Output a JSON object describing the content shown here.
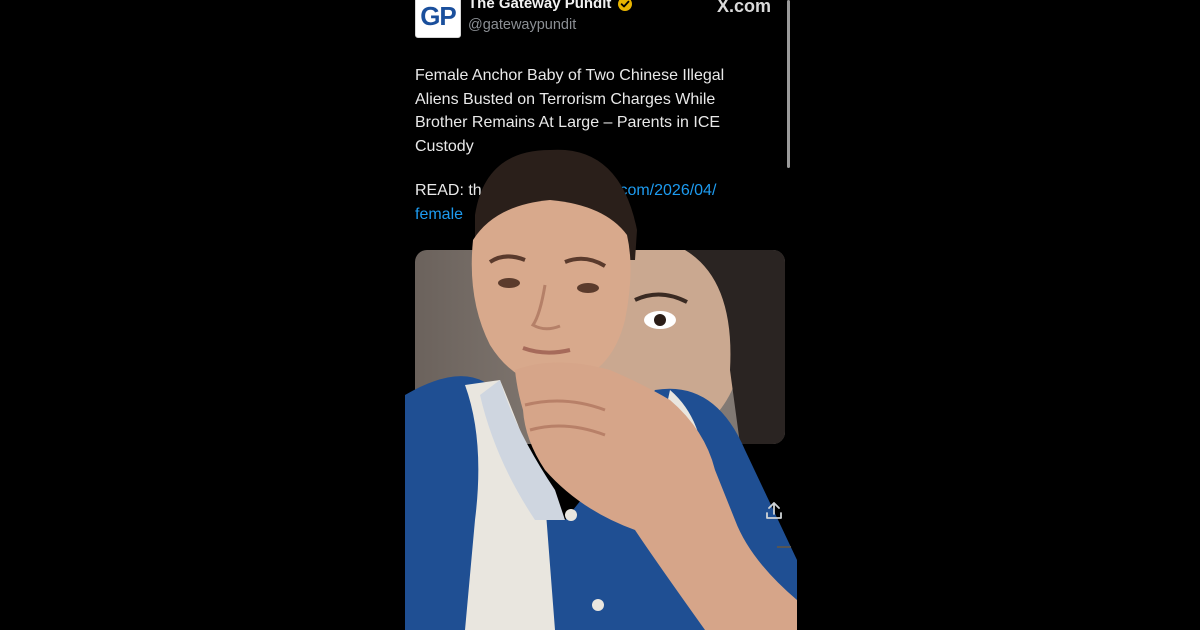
{
  "tweet": {
    "author_name": "The Gateway Pundit",
    "author_handle": "@gatewaypundit",
    "logo_text": "GP",
    "platform_label": "X.com",
    "body": "Female Anchor Baby of Two Chinese Illegal Aliens Busted on Terrorism Charges While Brother Remains At Large – Parents in ICE Custody",
    "read_prefix": "READ: th",
    "link_visible_end": ".com/2026/04/",
    "link_line2": "female"
  },
  "icons": {
    "verified": "verified-badge-icon",
    "share": "share-icon"
  },
  "colors": {
    "background": "#000000",
    "text": "#e9e9e9",
    "handle": "#8b8f94",
    "link": "#1d9bf0",
    "verified": "#e8b400",
    "shirt_blue": "#1f4f93"
  }
}
